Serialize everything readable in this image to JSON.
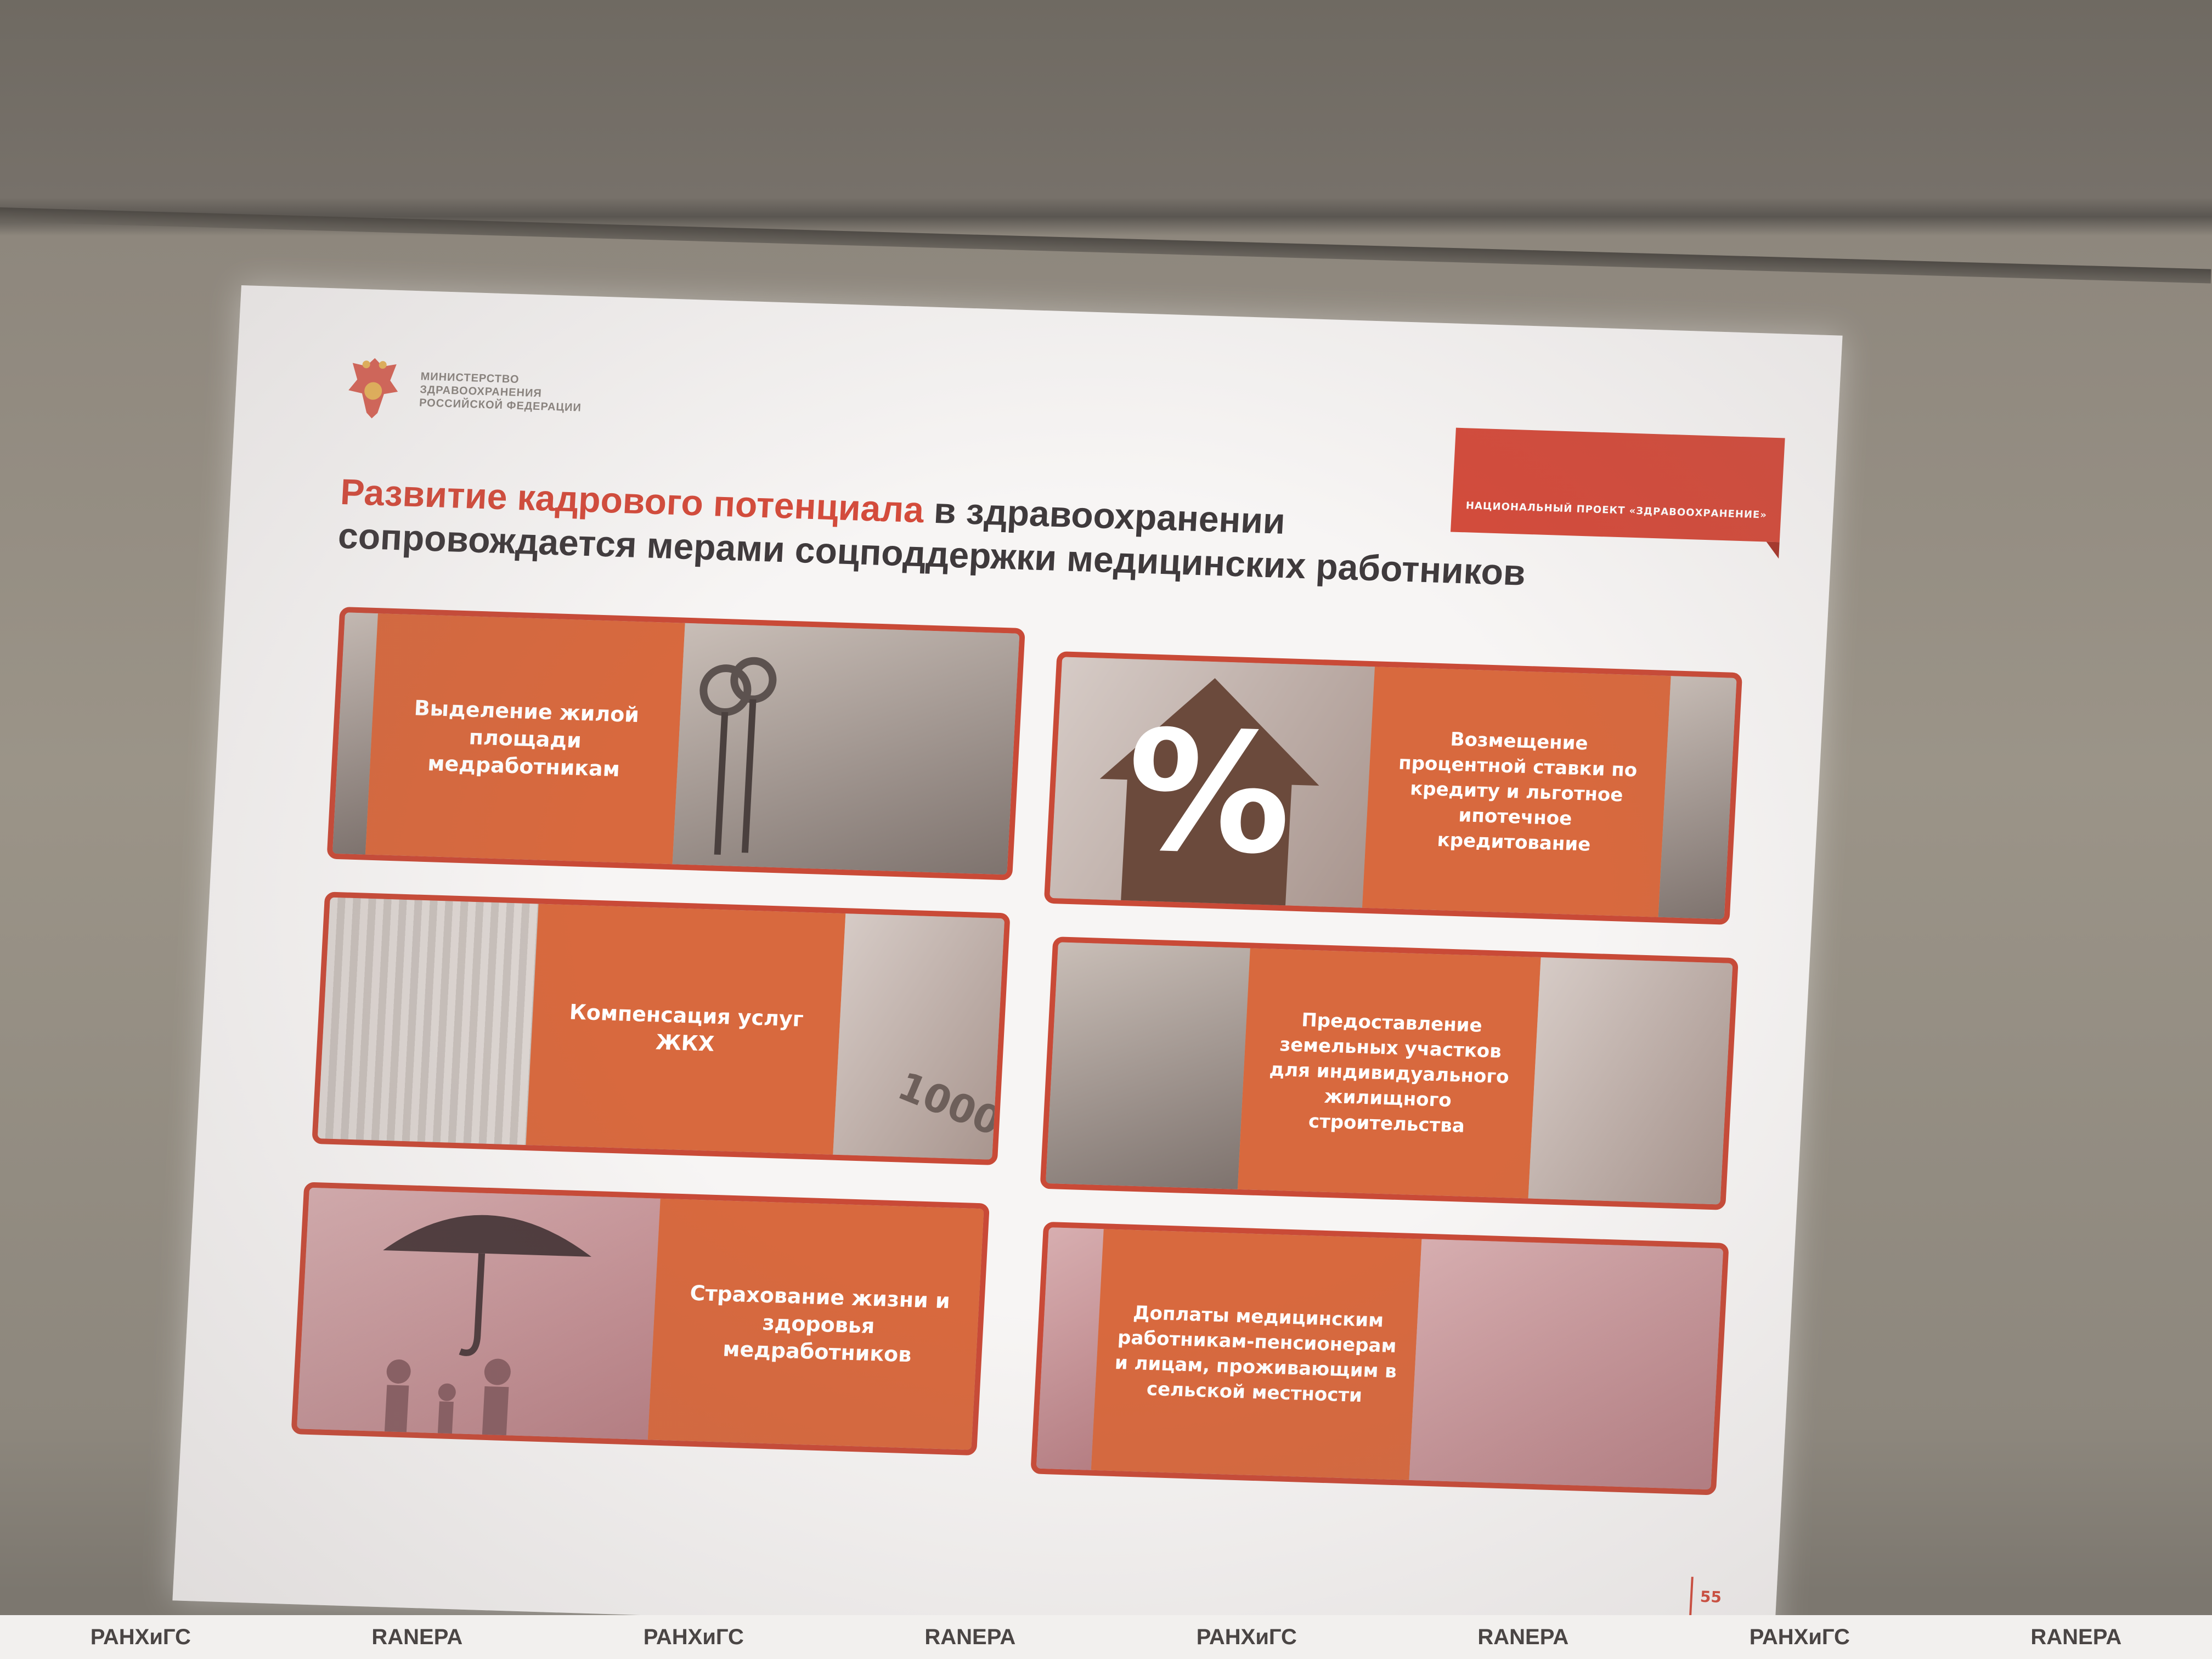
{
  "ministry": {
    "lines": [
      "МИНИСТЕРСТВО",
      "ЗДРАВООХРАНЕНИЯ",
      "РОССИЙСКОЙ ФЕДЕРАЦИИ"
    ]
  },
  "project_tag": "НАЦИОНАЛЬНЫЙ ПРОЕКТ «ЗДРАВООХРАНЕНИЕ»",
  "title": {
    "accent": "Развитие кадрового потенциала",
    "line1_rest": " в здравоохранении",
    "line2": "сопровождается мерами соцподдержки медицинских работников"
  },
  "cards": [
    {
      "label": "Выделение жилой площади медработникам"
    },
    {
      "label": "Возмещение процентной ставки по кредиту и льготное ипотечное кредитование",
      "symbol": "%"
    },
    {
      "label": "Компенсация услуг ЖКХ",
      "banknote": "1000"
    },
    {
      "label": "Предоставление земельных участков для индивидуального жилищного строительства"
    },
    {
      "label": "Страхование жизни и здоровья медработников"
    },
    {
      "label": "Доплаты медицинским работникам-пенсионерам и лицам, проживающим в сельской местности"
    }
  ],
  "page_number": "55",
  "banner": {
    "items": [
      "РАНХиГС",
      "RANEPA",
      "РАНХиГС",
      "RANEPA",
      "РАНХиГС",
      "RANEPA",
      "РАНХиГС",
      "RANEPA"
    ]
  },
  "colors": {
    "accent": "#d44b3b",
    "panel": "#d8693e"
  }
}
